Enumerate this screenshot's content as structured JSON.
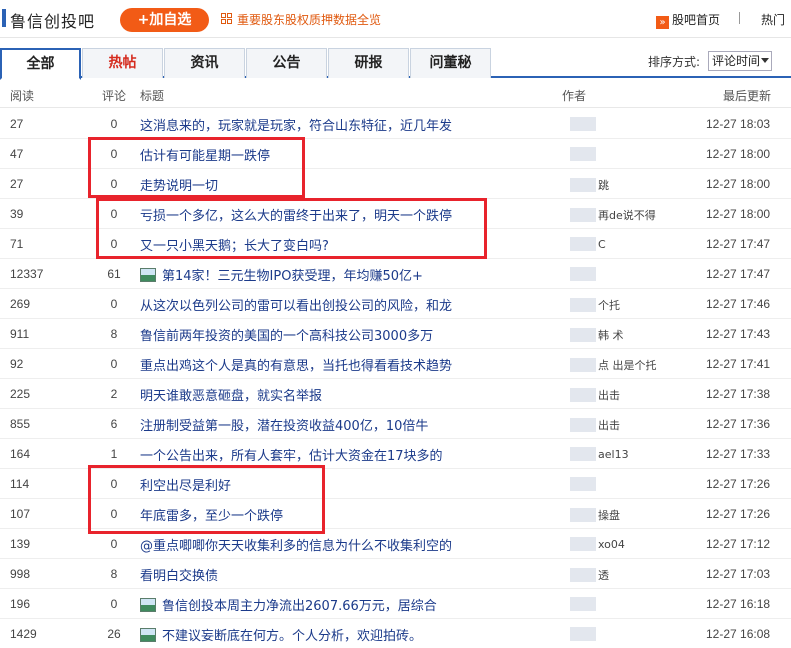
{
  "header": {
    "bar_title": "鲁信创投吧",
    "add_button": "+加自选",
    "promo": "重要股东股权质押数据全览",
    "home_link": "股吧首页",
    "hot_link": "热门"
  },
  "tabs": [
    "全部",
    "热帖",
    "资讯",
    "公告",
    "研报",
    "问董秘"
  ],
  "sort": {
    "label": "排序方式:",
    "value": "评论时间"
  },
  "columns": {
    "read": "阅读",
    "comments": "评论",
    "title": "标题",
    "author": "作者",
    "updated": "最后更新"
  },
  "rows": [
    {
      "read": "27",
      "comments": "0",
      "title": "这消息来的，玩家就是玩家，符合山东特征，近几年发",
      "author": "",
      "time": "12-27 18:03",
      "icon": false
    },
    {
      "read": "47",
      "comments": "0",
      "title": "估计有可能星期一跌停",
      "author": "",
      "time": "12-27 18:00",
      "icon": false
    },
    {
      "read": "27",
      "comments": "0",
      "title": "走势说明一切",
      "author": "跳",
      "time": "12-27 18:00",
      "icon": false
    },
    {
      "read": "39",
      "comments": "0",
      "title": "亏损一个多亿，这么大的雷终于出来了，明天一个跌停",
      "author": "再de说不得",
      "time": "12-27 18:00",
      "icon": false
    },
    {
      "read": "71",
      "comments": "0",
      "title": "又一只小黑天鹅；长大了变白吗?",
      "author": "C",
      "time": "12-27 17:47",
      "icon": false
    },
    {
      "read": "12337",
      "comments": "61",
      "title": "第14家！三元生物IPO获受理，年均赚50亿+",
      "author": "",
      "time": "12-27 17:47",
      "icon": true
    },
    {
      "read": "269",
      "comments": "0",
      "title": "从这次以色列公司的雷可以看出创投公司的风险，和龙",
      "author": "个托",
      "time": "12-27 17:46",
      "icon": false
    },
    {
      "read": "911",
      "comments": "8",
      "title": "鲁信前两年投资的美国的一个高科技公司3000多万",
      "author": "韩 术",
      "time": "12-27 17:43",
      "icon": false
    },
    {
      "read": "92",
      "comments": "0",
      "title": "重点出鸡这个人是真的有意思，当托也得看看技术趋势",
      "author": "点 出是个托",
      "time": "12-27 17:41",
      "icon": false
    },
    {
      "read": "225",
      "comments": "2",
      "title": "明天谁敢恶意砸盘，就实名举报",
      "author": "出击",
      "time": "12-27 17:38",
      "icon": false
    },
    {
      "read": "855",
      "comments": "6",
      "title": "注册制受益第一股，潜在投资收益400亿，10倍牛",
      "author": "出击",
      "time": "12-27 17:36",
      "icon": false
    },
    {
      "read": "164",
      "comments": "1",
      "title": "一个公告出来，所有人套牢，估计大资金在17块多的",
      "author": "ael13",
      "time": "12-27 17:33",
      "icon": false
    },
    {
      "read": "114",
      "comments": "0",
      "title": "利空出尽是利好",
      "author": "",
      "time": "12-27 17:26",
      "icon": false
    },
    {
      "read": "107",
      "comments": "0",
      "title": "年底雷多，至少一个跌停",
      "author": "操盘",
      "time": "12-27 17:26",
      "icon": false
    },
    {
      "read": "139",
      "comments": "0",
      "title": "@重点唧唧你天天收集利多的信息为什么不收集利空的",
      "author": "xo04",
      "time": "12-27 17:12",
      "icon": false
    },
    {
      "read": "998",
      "comments": "8",
      "title": "看明白交换债",
      "author": "透",
      "time": "12-27 17:03",
      "icon": false
    },
    {
      "read": "196",
      "comments": "0",
      "title": "鲁信创投本周主力净流出2607.66万元，居综合",
      "author": "",
      "time": "12-27 16:18",
      "icon": true
    },
    {
      "read": "1429",
      "comments": "26",
      "title": "不建议妄断底在何方。个人分析，欢迎拍砖。",
      "author": "",
      "time": "12-27 16:08",
      "icon": true
    }
  ],
  "colors": {
    "accent": "#f25b16",
    "link": "#1b3a8a",
    "tab_border": "#2b62b5",
    "highlight": "#e8232c"
  },
  "icons": [
    "promo-grid-icon",
    "guba-arrow-icon",
    "picture-icon"
  ]
}
